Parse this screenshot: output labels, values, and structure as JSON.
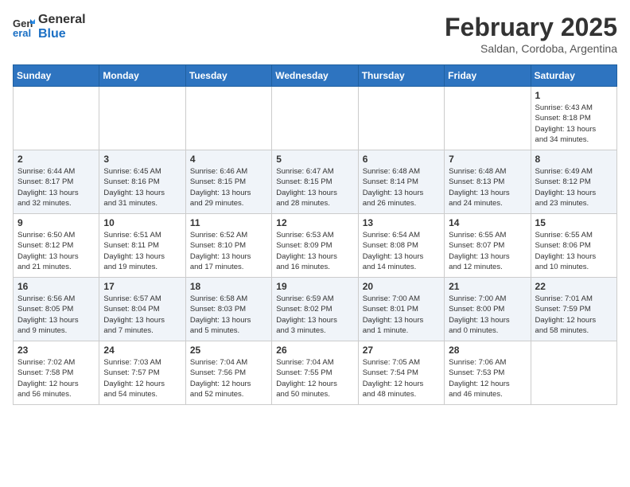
{
  "header": {
    "logo_line1": "General",
    "logo_line2": "Blue",
    "month": "February 2025",
    "location": "Saldan, Cordoba, Argentina"
  },
  "weekdays": [
    "Sunday",
    "Monday",
    "Tuesday",
    "Wednesday",
    "Thursday",
    "Friday",
    "Saturday"
  ],
  "weeks": [
    [
      {
        "day": "",
        "info": ""
      },
      {
        "day": "",
        "info": ""
      },
      {
        "day": "",
        "info": ""
      },
      {
        "day": "",
        "info": ""
      },
      {
        "day": "",
        "info": ""
      },
      {
        "day": "",
        "info": ""
      },
      {
        "day": "1",
        "info": "Sunrise: 6:43 AM\nSunset: 8:18 PM\nDaylight: 13 hours\nand 34 minutes."
      }
    ],
    [
      {
        "day": "2",
        "info": "Sunrise: 6:44 AM\nSunset: 8:17 PM\nDaylight: 13 hours\nand 32 minutes."
      },
      {
        "day": "3",
        "info": "Sunrise: 6:45 AM\nSunset: 8:16 PM\nDaylight: 13 hours\nand 31 minutes."
      },
      {
        "day": "4",
        "info": "Sunrise: 6:46 AM\nSunset: 8:15 PM\nDaylight: 13 hours\nand 29 minutes."
      },
      {
        "day": "5",
        "info": "Sunrise: 6:47 AM\nSunset: 8:15 PM\nDaylight: 13 hours\nand 28 minutes."
      },
      {
        "day": "6",
        "info": "Sunrise: 6:48 AM\nSunset: 8:14 PM\nDaylight: 13 hours\nand 26 minutes."
      },
      {
        "day": "7",
        "info": "Sunrise: 6:48 AM\nSunset: 8:13 PM\nDaylight: 13 hours\nand 24 minutes."
      },
      {
        "day": "8",
        "info": "Sunrise: 6:49 AM\nSunset: 8:12 PM\nDaylight: 13 hours\nand 23 minutes."
      }
    ],
    [
      {
        "day": "9",
        "info": "Sunrise: 6:50 AM\nSunset: 8:12 PM\nDaylight: 13 hours\nand 21 minutes."
      },
      {
        "day": "10",
        "info": "Sunrise: 6:51 AM\nSunset: 8:11 PM\nDaylight: 13 hours\nand 19 minutes."
      },
      {
        "day": "11",
        "info": "Sunrise: 6:52 AM\nSunset: 8:10 PM\nDaylight: 13 hours\nand 17 minutes."
      },
      {
        "day": "12",
        "info": "Sunrise: 6:53 AM\nSunset: 8:09 PM\nDaylight: 13 hours\nand 16 minutes."
      },
      {
        "day": "13",
        "info": "Sunrise: 6:54 AM\nSunset: 8:08 PM\nDaylight: 13 hours\nand 14 minutes."
      },
      {
        "day": "14",
        "info": "Sunrise: 6:55 AM\nSunset: 8:07 PM\nDaylight: 13 hours\nand 12 minutes."
      },
      {
        "day": "15",
        "info": "Sunrise: 6:55 AM\nSunset: 8:06 PM\nDaylight: 13 hours\nand 10 minutes."
      }
    ],
    [
      {
        "day": "16",
        "info": "Sunrise: 6:56 AM\nSunset: 8:05 PM\nDaylight: 13 hours\nand 9 minutes."
      },
      {
        "day": "17",
        "info": "Sunrise: 6:57 AM\nSunset: 8:04 PM\nDaylight: 13 hours\nand 7 minutes."
      },
      {
        "day": "18",
        "info": "Sunrise: 6:58 AM\nSunset: 8:03 PM\nDaylight: 13 hours\nand 5 minutes."
      },
      {
        "day": "19",
        "info": "Sunrise: 6:59 AM\nSunset: 8:02 PM\nDaylight: 13 hours\nand 3 minutes."
      },
      {
        "day": "20",
        "info": "Sunrise: 7:00 AM\nSunset: 8:01 PM\nDaylight: 13 hours\nand 1 minute."
      },
      {
        "day": "21",
        "info": "Sunrise: 7:00 AM\nSunset: 8:00 PM\nDaylight: 13 hours\nand 0 minutes."
      },
      {
        "day": "22",
        "info": "Sunrise: 7:01 AM\nSunset: 7:59 PM\nDaylight: 12 hours\nand 58 minutes."
      }
    ],
    [
      {
        "day": "23",
        "info": "Sunrise: 7:02 AM\nSunset: 7:58 PM\nDaylight: 12 hours\nand 56 minutes."
      },
      {
        "day": "24",
        "info": "Sunrise: 7:03 AM\nSunset: 7:57 PM\nDaylight: 12 hours\nand 54 minutes."
      },
      {
        "day": "25",
        "info": "Sunrise: 7:04 AM\nSunset: 7:56 PM\nDaylight: 12 hours\nand 52 minutes."
      },
      {
        "day": "26",
        "info": "Sunrise: 7:04 AM\nSunset: 7:55 PM\nDaylight: 12 hours\nand 50 minutes."
      },
      {
        "day": "27",
        "info": "Sunrise: 7:05 AM\nSunset: 7:54 PM\nDaylight: 12 hours\nand 48 minutes."
      },
      {
        "day": "28",
        "info": "Sunrise: 7:06 AM\nSunset: 7:53 PM\nDaylight: 12 hours\nand 46 minutes."
      },
      {
        "day": "",
        "info": ""
      }
    ]
  ]
}
